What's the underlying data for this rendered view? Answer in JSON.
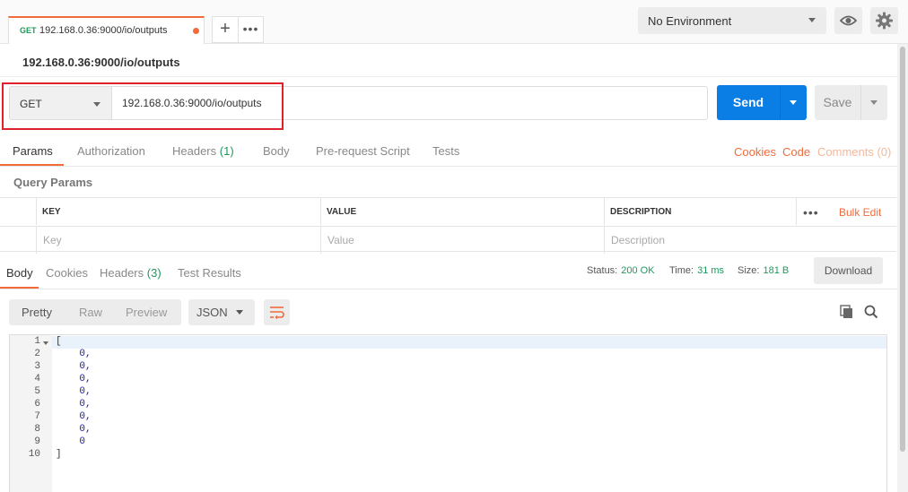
{
  "tabbar": {
    "tab": {
      "method": "GET",
      "title": "192.168.0.36:9000/io/outputs",
      "unsaved": true
    },
    "add_icon": "+",
    "more_icon": "•••"
  },
  "environment": {
    "selected": "No Environment"
  },
  "request": {
    "name": "192.168.0.36:9000/io/outputs",
    "method": "GET",
    "url": "192.168.0.36:9000/io/outputs",
    "send_label": "Send",
    "save_label": "Save"
  },
  "request_tabs": {
    "params": "Params",
    "authorization": "Authorization",
    "headers": "Headers",
    "headers_count": "(1)",
    "body": "Body",
    "prerequest": "Pre-request Script",
    "tests": "Tests",
    "cookies": "Cookies",
    "code": "Code",
    "comments": "Comments (0)"
  },
  "query_params": {
    "title": "Query Params",
    "headers": {
      "key": "KEY",
      "value": "VALUE",
      "description": "DESCRIPTION"
    },
    "more_icon": "•••",
    "bulk_edit": "Bulk Edit",
    "placeholders": {
      "key": "Key",
      "value": "Value",
      "description": "Description"
    }
  },
  "response": {
    "tabs": {
      "body": "Body",
      "cookies": "Cookies",
      "headers": "Headers",
      "headers_count": "(3)",
      "test_results": "Test Results"
    },
    "status_label": "Status:",
    "status_value": "200 OK",
    "time_label": "Time:",
    "time_value": "31 ms",
    "size_label": "Size:",
    "size_value": "181 B",
    "download_label": "Download",
    "format": {
      "pretty": "Pretty",
      "raw": "Raw",
      "preview": "Preview",
      "language": "JSON"
    },
    "line_numbers": [
      "1",
      "2",
      "3",
      "4",
      "5",
      "6",
      "7",
      "8",
      "9",
      "10"
    ],
    "lines": [
      "[",
      "    0,",
      "    0,",
      "    0,",
      "    0,",
      "    0,",
      "    0,",
      "    0,",
      "    0",
      "]"
    ]
  },
  "colors": {
    "accent": "#f26b3a",
    "send": "#0b7ee6",
    "success": "#1d9a5c",
    "annotation": "#e0202a"
  },
  "icons": {
    "eye": "eye-icon",
    "gear": "gear-icon",
    "wrap": "wrap-lines-icon",
    "copy": "copy-icon",
    "search": "search-icon"
  }
}
